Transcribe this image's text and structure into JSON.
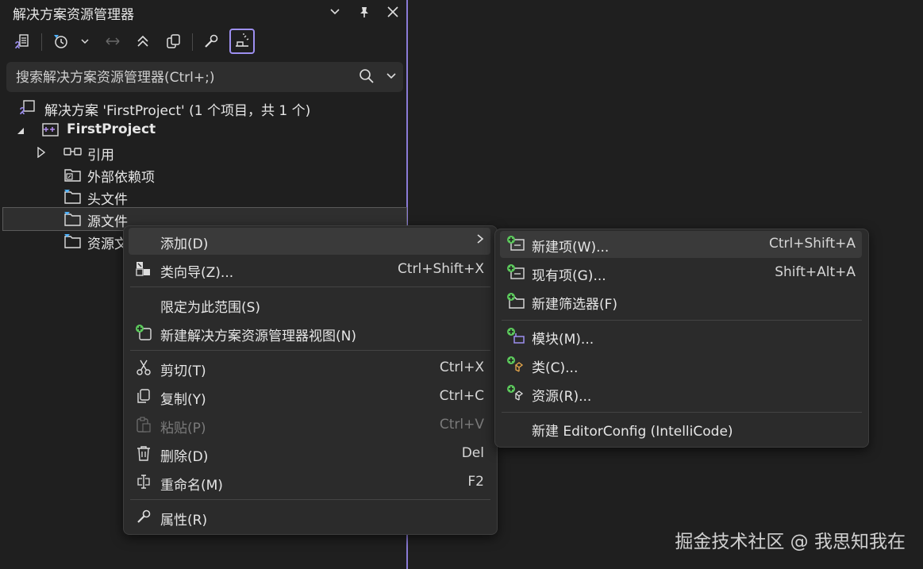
{
  "panel": {
    "title": "解决方案资源管理器",
    "search_placeholder": "搜索解决方案资源管理器(Ctrl+;)"
  },
  "tree": {
    "solution": "解决方案 'FirstProject' (1 个项目，共 1 个)",
    "project": "FirstProject",
    "references": "引用",
    "external_deps": "外部依赖项",
    "header_files": "头文件",
    "source_files": "源文件",
    "resource_files": "资源文"
  },
  "context_menu": {
    "add": "添加(D)",
    "class_wizard": "类向导(Z)...",
    "class_wizard_shortcut": "Ctrl+Shift+X",
    "scope_to_this": "限定为此范围(S)",
    "new_solution_view": "新建解决方案资源管理器视图(N)",
    "cut": "剪切(T)",
    "cut_shortcut": "Ctrl+X",
    "copy": "复制(Y)",
    "copy_shortcut": "Ctrl+C",
    "paste": "粘贴(P)",
    "paste_shortcut": "Ctrl+V",
    "delete": "删除(D)",
    "delete_shortcut": "Del",
    "rename": "重命名(M)",
    "rename_shortcut": "F2",
    "properties": "属性(R)"
  },
  "submenu": {
    "new_item": "新建项(W)...",
    "new_item_shortcut": "Ctrl+Shift+A",
    "existing_item": "现有项(G)...",
    "existing_item_shortcut": "Shift+Alt+A",
    "new_filter": "新建筛选器(F)",
    "module": "模块(M)...",
    "class": "类(C)...",
    "resource": "资源(R)...",
    "editorconfig": "新建 EditorConfig (IntelliCode)"
  },
  "watermark": "掘金技术社区 @ 我思知我在",
  "colors": {
    "accent": "#8a7bd6",
    "background": "#1f1f1f",
    "menu_background": "#2b2b2b",
    "add_badge": "#5cc95c"
  }
}
